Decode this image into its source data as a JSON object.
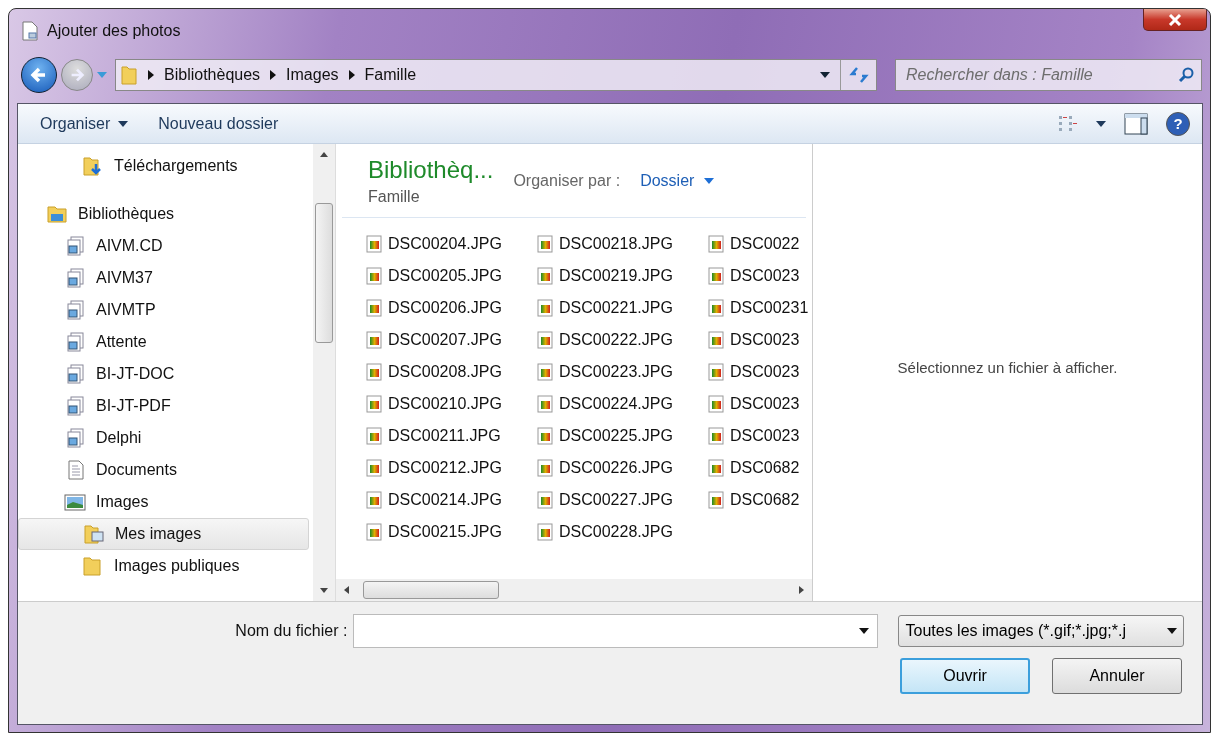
{
  "window": {
    "title": "Ajouter des photos"
  },
  "address_bar": {
    "path": [
      "Bibliothèques",
      "Images",
      "Famille"
    ]
  },
  "search": {
    "placeholder": "Rechercher dans : Famille"
  },
  "toolbar": {
    "help_glyph": "?",
    "buttons": [
      {
        "label": "Organiser",
        "kind": "menu"
      },
      {
        "label": "Nouveau dossier",
        "kind": "plain"
      }
    ]
  },
  "navigation": {
    "items": [
      {
        "label": "Téléchargements",
        "kind": "download",
        "selected": false
      },
      {
        "label": "Bibliothèques",
        "kind": "library",
        "selected": false,
        "children": [
          {
            "label": "AIVM.CD",
            "kind": "shared",
            "selected": false
          },
          {
            "label": "AIVM37",
            "kind": "shared",
            "selected": false
          },
          {
            "label": "AIVMTP",
            "kind": "shared",
            "selected": false
          },
          {
            "label": "Attente",
            "kind": "shared",
            "selected": false
          },
          {
            "label": "BI-JT-DOC",
            "kind": "shared",
            "selected": false
          },
          {
            "label": "BI-JT-PDF",
            "kind": "shared",
            "selected": false
          },
          {
            "label": "Delphi",
            "kind": "shared",
            "selected": false
          },
          {
            "label": "Documents",
            "kind": "documents",
            "selected": false
          },
          {
            "label": "Images",
            "kind": "pictures",
            "selected": false,
            "children": [
              {
                "label": "Mes images",
                "kind": "picture-folder",
                "selected": true
              },
              {
                "label": "Images publiques",
                "kind": "folder",
                "selected": false
              }
            ]
          }
        ]
      }
    ]
  },
  "content": {
    "title": "Bibliothèq...",
    "subtitle": "Famille",
    "arrange_label": "Organiser par :",
    "arrange_value": "Dossier",
    "files": [
      "DSC00204.JPG",
      "DSC00205.JPG",
      "DSC00206.JPG",
      "DSC00207.JPG",
      "DSC00208.JPG",
      "DSC00210.JPG",
      "DSC00211.JPG",
      "DSC00212.JPG",
      "DSC00214.JPG",
      "DSC00215.JPG",
      "DSC00218.JPG",
      "DSC00219.JPG",
      "DSC00221.JPG",
      "DSC00222.JPG",
      "DSC00223.JPG",
      "DSC00224.JPG",
      "DSC00225.JPG",
      "DSC00226.JPG",
      "DSC00227.JPG",
      "DSC00228.JPG",
      "DSC0022",
      "DSC0023",
      "DSC00231",
      "DSC0023",
      "DSC0023",
      "DSC0023",
      "DSC0023",
      "DSC0682",
      "DSC0682"
    ]
  },
  "preview": {
    "message": "Sélectionnez un fichier à afficher."
  },
  "footer": {
    "filename_label": "Nom du fichier :",
    "filter": "Toutes les images (*.gif;*.jpg;*.j",
    "buttons": [
      {
        "label": "Ouvrir",
        "default": true
      },
      {
        "label": "Annuler",
        "default": false
      }
    ]
  }
}
